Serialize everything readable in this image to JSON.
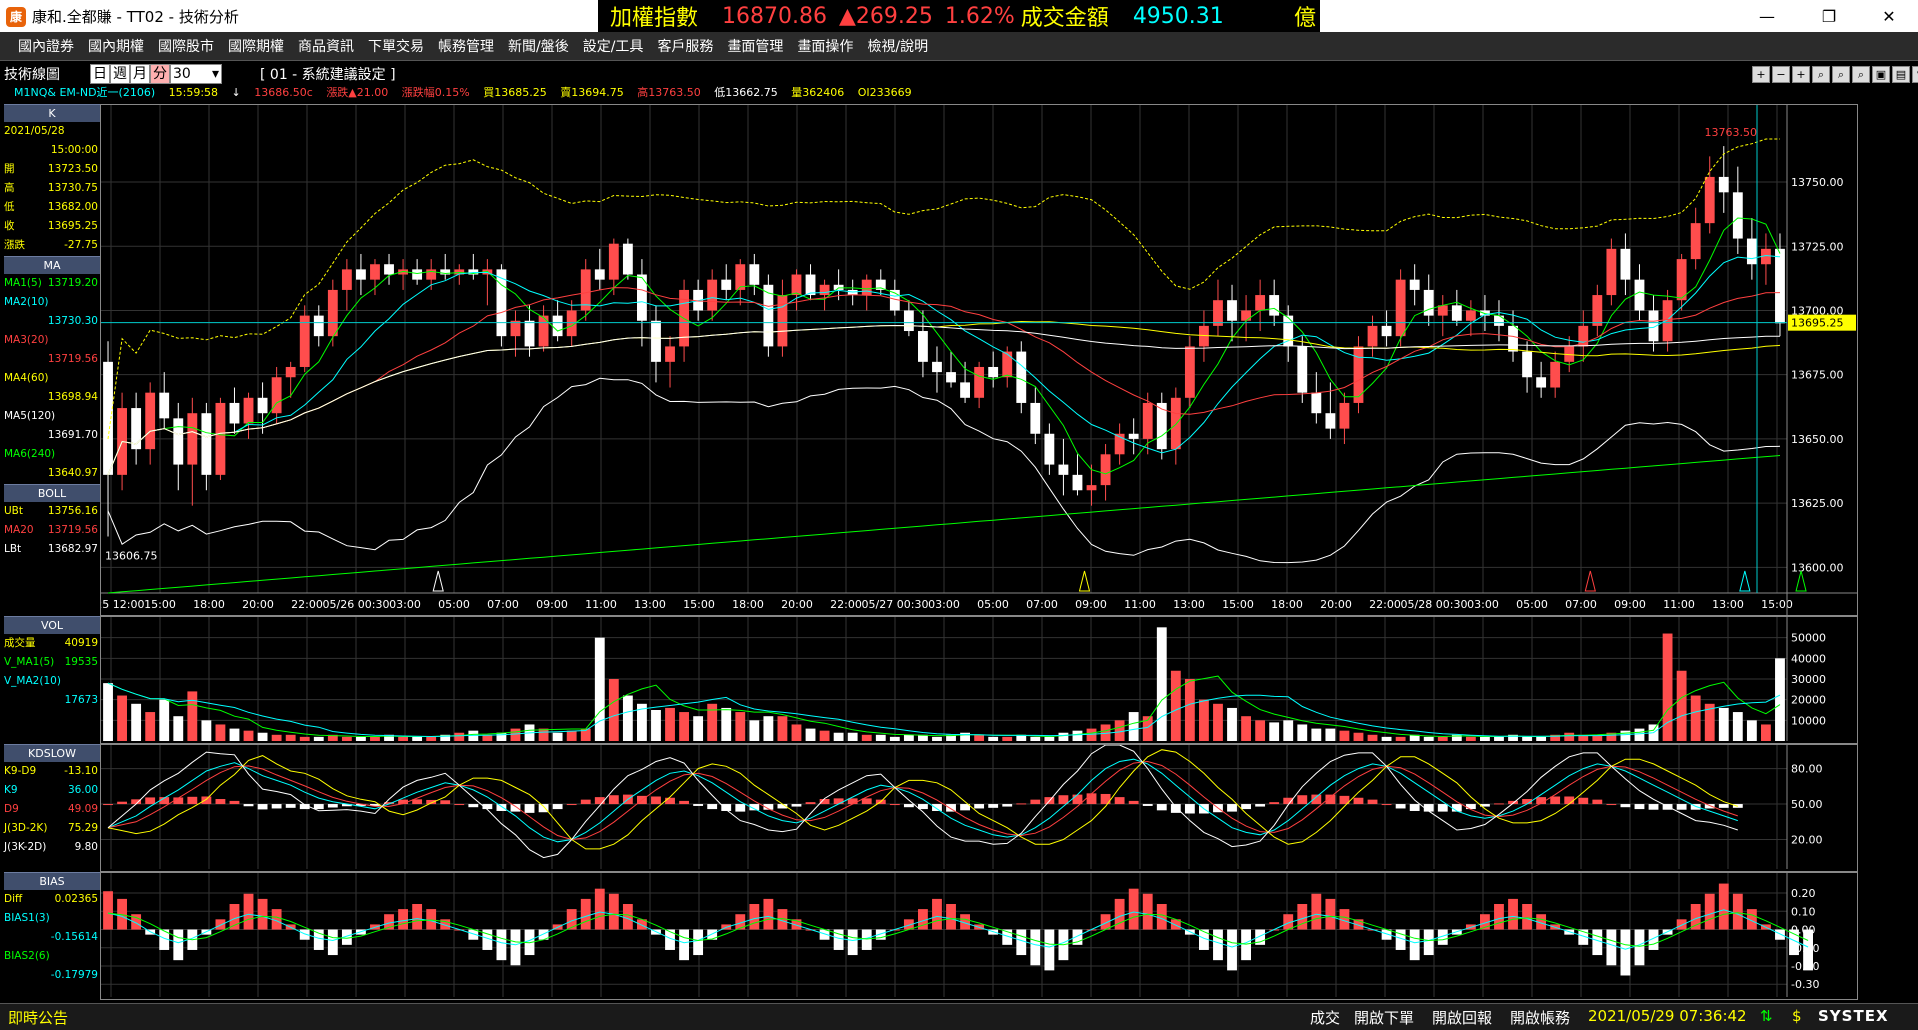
{
  "window": {
    "title": "康和.全都賺 - TT02 - 技術分析",
    "logo_char": "康"
  },
  "ticker": {
    "label": "加權指數",
    "value": "16870.86",
    "change": "▲269.25",
    "percent": "1.62%",
    "turnover_label": "成交金額",
    "turnover": "4950.31",
    "unit": "億",
    "colors": {
      "label": "#ffff00",
      "value": "#ff4040",
      "amount": "#00ffff"
    }
  },
  "menu": [
    "國內證券",
    "國內期權",
    "國際股市",
    "國際期權",
    "商品資訊",
    "下單交易",
    "帳務管理",
    "新聞/盤後",
    "設定/工具",
    "客戶服務",
    "畫面管理",
    "畫面操作",
    "檢視/說明"
  ],
  "toolbar": {
    "panel_title": "技術線圖",
    "periods": [
      "日",
      "週",
      "月",
      "分"
    ],
    "interval": "30",
    "setting": "[ 01 - 系統建議設定 ]"
  },
  "infoline": {
    "symbol": "M1NQ& EM-ND近一(2106)",
    "time": "15:59:58",
    "arrow": "↓",
    "last": "13686.50c",
    "change": "漲跌▲21.00",
    "pct": "漲跌幅0.15%",
    "buy": "買13685.25",
    "sell": "賣13694.75",
    "high": "高13763.50",
    "low": "低13662.75",
    "vol": "量362406",
    "oi": "OI233669"
  },
  "k_panel": {
    "head": "K",
    "date": "2021/05/28",
    "time": "15:00:00",
    "rows": [
      {
        "label": "開",
        "value": "13723.50"
      },
      {
        "label": "高",
        "value": "13730.75"
      },
      {
        "label": "低",
        "value": "13682.00"
      },
      {
        "label": "收",
        "value": "13695.25"
      },
      {
        "label": "漲跌",
        "value": "-27.75"
      }
    ]
  },
  "ma_panel": {
    "head": "MA",
    "rows": [
      {
        "label": "MA1(5)",
        "value": "13719.20",
        "color": "#00ff00"
      },
      {
        "label": "MA2(10)",
        "value": "",
        "color": "#00ffff"
      },
      {
        "label": "",
        "value": "13730.30",
        "color": "#00ffff"
      },
      {
        "label": "MA3(20)",
        "value": "",
        "color": "#ff4040"
      },
      {
        "label": "",
        "value": "13719.56",
        "color": "#ff4040"
      },
      {
        "label": "MA4(60)",
        "value": "",
        "color": "#ffff00"
      },
      {
        "label": "",
        "value": "13698.94",
        "color": "#ffff00"
      },
      {
        "label": "MA5(120)",
        "value": "",
        "color": "#ffffff"
      },
      {
        "label": "",
        "value": "13691.70",
        "color": "#ffffff"
      },
      {
        "label": "MA6(240)",
        "value": "",
        "color": "#00ff00"
      },
      {
        "label": "",
        "value": "13640.97",
        "color": "#ffff00"
      }
    ]
  },
  "boll_panel": {
    "head": "BOLL",
    "rows": [
      {
        "label": "UBt",
        "value": "13756.16",
        "color": "#ffff00"
      },
      {
        "label": "MA20",
        "value": "13719.56",
        "color": "#ff4040"
      },
      {
        "label": "LBt",
        "value": "13682.97",
        "color": "#ffffff"
      }
    ]
  },
  "vol_panel": {
    "head": "VOL",
    "rows": [
      {
        "label": "成交量",
        "value": "40919",
        "color": "#ffff00"
      },
      {
        "label": "V_MA1(5)",
        "value": "19535",
        "color": "#00ff00"
      },
      {
        "label": "V_MA2(10)",
        "value": "",
        "color": "#00ffff"
      },
      {
        "label": "",
        "value": "17673",
        "color": "#00ffff"
      }
    ]
  },
  "kd_panel": {
    "head": "KDSLOW",
    "rows": [
      {
        "label": "K9-D9",
        "value": "-13.10",
        "color": "#ffff00"
      },
      {
        "label": "K9",
        "value": "36.00",
        "color": "#00ffff"
      },
      {
        "label": "D9",
        "value": "49.09",
        "color": "#ff4040"
      },
      {
        "label": "J(3D-2K)",
        "value": "75.29",
        "color": "#ffff00"
      },
      {
        "label": "J(3K-2D)",
        "value": "9.80",
        "color": "#ffffff"
      }
    ]
  },
  "bias_panel": {
    "head": "BIAS",
    "rows": [
      {
        "label": "Diff",
        "value": "0.02365",
        "color": "#ffff00"
      },
      {
        "label": "BIAS1(3)",
        "value": "",
        "color": "#00ffff"
      },
      {
        "label": "",
        "value": "-0.15614",
        "color": "#00ffff"
      },
      {
        "label": "BIAS2(6)",
        "value": "",
        "color": "#00ff00"
      },
      {
        "label": "",
        "value": "-0.17979",
        "color": "#00ffff"
      }
    ]
  },
  "chart_data": {
    "type": "candlestick",
    "price_ticks": [
      "13750.00",
      "13725.00",
      "13700.00",
      "13675.00",
      "13650.00",
      "13625.00",
      "13600.00"
    ],
    "price_range": [
      13590,
      13780
    ],
    "current_price": "13695.25",
    "high_label": "13763.50",
    "low_label": "13606.75",
    "time_ticks": [
      "05/25 12:00",
      "15:00",
      "18:00",
      "20:00",
      "22:00",
      "05/26 00:30",
      "03:00",
      "05:00",
      "07:00",
      "09:00",
      "11:00",
      "13:00",
      "15:00",
      "18:00",
      "20:00",
      "22:00",
      "05/27 00:30",
      "03:00",
      "05:00",
      "07:00",
      "09:00",
      "11:00",
      "13:00",
      "15:00",
      "18:00",
      "20:00",
      "22:00",
      "05/28 00:30",
      "03:00",
      "05:00",
      "07:00",
      "09:00",
      "11:00",
      "13:00",
      "15:00"
    ],
    "vol_ticks": [
      "50000",
      "40000",
      "30000",
      "20000",
      "10000"
    ],
    "kd_ticks": [
      "80.00",
      "50.00",
      "20.00"
    ],
    "bias_ticks": [
      "0.20",
      "0.10",
      "0.00",
      "-0.10",
      "-0.20",
      "-0.30"
    ],
    "candles": [
      [
        13680,
        13688,
        13612,
        13636
      ],
      [
        13636,
        13668,
        13630,
        13662
      ],
      [
        13662,
        13668,
        13640,
        13646
      ],
      [
        13646,
        13672,
        13640,
        13668
      ],
      [
        13668,
        13676,
        13654,
        13658
      ],
      [
        13658,
        13664,
        13630,
        13640
      ],
      [
        13640,
        13666,
        13624,
        13660
      ],
      [
        13660,
        13664,
        13630,
        13636
      ],
      [
        13636,
        13666,
        13634,
        13664
      ],
      [
        13664,
        13670,
        13652,
        13656
      ],
      [
        13656,
        13668,
        13650,
        13666
      ],
      [
        13666,
        13672,
        13652,
        13660
      ],
      [
        13660,
        13678,
        13656,
        13674
      ],
      [
        13674,
        13680,
        13666,
        13678
      ],
      [
        13678,
        13702,
        13676,
        13698
      ],
      [
        13698,
        13702,
        13686,
        13690
      ],
      [
        13690,
        13712,
        13686,
        13708
      ],
      [
        13708,
        13720,
        13700,
        13716
      ],
      [
        13716,
        13722,
        13706,
        13712
      ],
      [
        13712,
        13720,
        13706,
        13718
      ],
      [
        13718,
        13722,
        13710,
        13714
      ],
      [
        13714,
        13720,
        13708,
        13716
      ],
      [
        13716,
        13720,
        13710,
        13712
      ],
      [
        13712,
        13720,
        13708,
        13716
      ],
      [
        13716,
        13722,
        13712,
        13714
      ],
      [
        13714,
        13718,
        13710,
        13716
      ],
      [
        13716,
        13722,
        13712,
        13714
      ],
      [
        13714,
        13720,
        13702,
        13716
      ],
      [
        13716,
        13718,
        13686,
        13690
      ],
      [
        13690,
        13700,
        13682,
        13696
      ],
      [
        13696,
        13702,
        13682,
        13686
      ],
      [
        13686,
        13702,
        13684,
        13698
      ],
      [
        13698,
        13704,
        13688,
        13690
      ],
      [
        13690,
        13704,
        13686,
        13700
      ],
      [
        13700,
        13720,
        13696,
        13716
      ],
      [
        13716,
        13724,
        13708,
        13712
      ],
      [
        13712,
        13728,
        13706,
        13726
      ],
      [
        13726,
        13728,
        13712,
        13714
      ],
      [
        13714,
        13720,
        13686,
        13696
      ],
      [
        13696,
        13702,
        13672,
        13680
      ],
      [
        13680,
        13690,
        13670,
        13686
      ],
      [
        13686,
        13712,
        13680,
        13708
      ],
      [
        13708,
        13712,
        13696,
        13700
      ],
      [
        13700,
        13716,
        13696,
        13712
      ],
      [
        13712,
        13718,
        13704,
        13708
      ],
      [
        13708,
        13720,
        13702,
        13718
      ],
      [
        13718,
        13722,
        13706,
        13710
      ],
      [
        13710,
        13714,
        13682,
        13686
      ],
      [
        13686,
        13712,
        13682,
        13706
      ],
      [
        13706,
        13716,
        13700,
        13714
      ],
      [
        13714,
        13718,
        13704,
        13706
      ],
      [
        13706,
        13712,
        13700,
        13710
      ],
      [
        13710,
        13716,
        13704,
        13708
      ],
      [
        13708,
        13712,
        13702,
        13706
      ],
      [
        13706,
        13714,
        13700,
        13712
      ],
      [
        13712,
        13716,
        13706,
        13708
      ],
      [
        13708,
        13712,
        13698,
        13700
      ],
      [
        13700,
        13704,
        13690,
        13692
      ],
      [
        13692,
        13700,
        13674,
        13680
      ],
      [
        13680,
        13686,
        13668,
        13676
      ],
      [
        13676,
        13684,
        13670,
        13672
      ],
      [
        13672,
        13680,
        13664,
        13666
      ],
      [
        13666,
        13680,
        13662,
        13678
      ],
      [
        13678,
        13684,
        13670,
        13674
      ],
      [
        13674,
        13686,
        13670,
        13684
      ],
      [
        13684,
        13688,
        13660,
        13664
      ],
      [
        13664,
        13670,
        13648,
        13652
      ],
      [
        13652,
        13656,
        13636,
        13640
      ],
      [
        13640,
        13650,
        13628,
        13636
      ],
      [
        13636,
        13644,
        13628,
        13630
      ],
      [
        13630,
        13640,
        13624,
        13632
      ],
      [
        13632,
        13648,
        13626,
        13644
      ],
      [
        13644,
        13656,
        13640,
        13652
      ],
      [
        13652,
        13658,
        13644,
        13650
      ],
      [
        13650,
        13668,
        13644,
        13664
      ],
      [
        13664,
        13668,
        13642,
        13646
      ],
      [
        13646,
        13670,
        13640,
        13666
      ],
      [
        13666,
        13690,
        13662,
        13686
      ],
      [
        13686,
        13700,
        13680,
        13694
      ],
      [
        13694,
        13712,
        13690,
        13704
      ],
      [
        13704,
        13710,
        13688,
        13696
      ],
      [
        13696,
        13706,
        13688,
        13700
      ],
      [
        13700,
        13712,
        13692,
        13706
      ],
      [
        13706,
        13712,
        13694,
        13698
      ],
      [
        13698,
        13702,
        13680,
        13686
      ],
      [
        13686,
        13690,
        13664,
        13668
      ],
      [
        13668,
        13676,
        13656,
        13660
      ],
      [
        13660,
        13672,
        13650,
        13654
      ],
      [
        13654,
        13668,
        13648,
        13664
      ],
      [
        13664,
        13690,
        13660,
        13686
      ],
      [
        13686,
        13698,
        13682,
        13694
      ],
      [
        13694,
        13700,
        13686,
        13690
      ],
      [
        13690,
        13716,
        13686,
        13712
      ],
      [
        13712,
        13718,
        13702,
        13708
      ],
      [
        13708,
        13714,
        13694,
        13698
      ],
      [
        13698,
        13706,
        13690,
        13702
      ],
      [
        13702,
        13708,
        13694,
        13696
      ],
      [
        13696,
        13704,
        13690,
        13700
      ],
      [
        13700,
        13706,
        13692,
        13698
      ],
      [
        13698,
        13704,
        13688,
        13694
      ],
      [
        13694,
        13700,
        13680,
        13684
      ],
      [
        13684,
        13688,
        13668,
        13674
      ],
      [
        13674,
        13680,
        13666,
        13670
      ],
      [
        13670,
        13684,
        13666,
        13680
      ],
      [
        13680,
        13690,
        13676,
        13686
      ],
      [
        13686,
        13700,
        13680,
        13694
      ],
      [
        13694,
        13710,
        13690,
        13706
      ],
      [
        13706,
        13728,
        13702,
        13724
      ],
      [
        13724,
        13730,
        13706,
        13712
      ],
      [
        13712,
        13718,
        13696,
        13700
      ],
      [
        13700,
        13706,
        13684,
        13688
      ],
      [
        13688,
        13708,
        13684,
        13704
      ],
      [
        13704,
        13722,
        13700,
        13720
      ],
      [
        13720,
        13740,
        13716,
        13734
      ],
      [
        13734,
        13760,
        13730,
        13752
      ],
      [
        13752,
        13764,
        13738,
        13746
      ],
      [
        13746,
        13756,
        13722,
        13728
      ],
      [
        13728,
        13736,
        13712,
        13718
      ],
      [
        13718,
        13730,
        13710,
        13724
      ],
      [
        13724,
        13730,
        13690,
        13695
      ]
    ],
    "volume": [
      28,
      22,
      18,
      14,
      20,
      12,
      24,
      10,
      8,
      6,
      5,
      4,
      3,
      3,
      2,
      2,
      3,
      2,
      2,
      2,
      3,
      2,
      2,
      2,
      3,
      4,
      5,
      3,
      4,
      6,
      8,
      6,
      4,
      5,
      6,
      50,
      30,
      22,
      18,
      15,
      16,
      14,
      12,
      18,
      16,
      14,
      10,
      12,
      12,
      8,
      6,
      5,
      4,
      4,
      3,
      3,
      2,
      3,
      3,
      2,
      3,
      4,
      3,
      2,
      2,
      3,
      2,
      2,
      4,
      5,
      6,
      8,
      10,
      14,
      12,
      55,
      34,
      30,
      20,
      18,
      16,
      12,
      10,
      9,
      10,
      8,
      6,
      6,
      5,
      4,
      3,
      2,
      2,
      3,
      2,
      2,
      3,
      2,
      2,
      2,
      3,
      2,
      2,
      3,
      4,
      3,
      3,
      4,
      5,
      6,
      8,
      52,
      34,
      22,
      18,
      16,
      14,
      10,
      8,
      40
    ],
    "kd_k": [
      30,
      35,
      40,
      48,
      55,
      62,
      70,
      78,
      82,
      85,
      80,
      74,
      70,
      66,
      60,
      55,
      52,
      50,
      48,
      46,
      50,
      55,
      60,
      64,
      68,
      66,
      62,
      56,
      48,
      40,
      30,
      22,
      18,
      20,
      26,
      34,
      44,
      54,
      62,
      70,
      76,
      78,
      74,
      68,
      60,
      52,
      46,
      40,
      36,
      34,
      38,
      44,
      50,
      56,
      62,
      66,
      64,
      60,
      54,
      46,
      38,
      32,
      28,
      24,
      22,
      24,
      30,
      38,
      48,
      58,
      70,
      80,
      86,
      88,
      84,
      76,
      66,
      56,
      46,
      38,
      30,
      26,
      24,
      28,
      36,
      46,
      56,
      66,
      74,
      80,
      84,
      82,
      76,
      68,
      60,
      52,
      44,
      40,
      38,
      40,
      44,
      50,
      58,
      66,
      74,
      80,
      84,
      82,
      78,
      72,
      66,
      60,
      54,
      48,
      44,
      40,
      36
    ],
    "bias1": [
      0.15,
      0.12,
      0.06,
      -0.02,
      -0.08,
      -0.12,
      -0.08,
      -0.02,
      0.04,
      0.1,
      0.14,
      0.12,
      0.08,
      0.02,
      -0.04,
      -0.08,
      -0.1,
      -0.06,
      -0.02,
      0.02,
      0.06,
      0.08,
      0.1,
      0.08,
      0.04,
      0.0,
      -0.04,
      -0.08,
      -0.12,
      -0.14,
      -0.1,
      -0.04,
      0.02,
      0.08,
      0.12,
      0.16,
      0.14,
      0.1,
      0.04,
      -0.02,
      -0.08,
      -0.12,
      -0.1,
      -0.04,
      0.02,
      0.06,
      0.1,
      0.12,
      0.08,
      0.04,
      0.0,
      -0.04,
      -0.08,
      -0.1,
      -0.08,
      -0.04,
      0.0,
      0.04,
      0.08,
      0.12,
      0.1,
      0.06,
      0.02,
      -0.02,
      -0.06,
      -0.1,
      -0.14,
      -0.16,
      -0.12,
      -0.06,
      0.0,
      0.06,
      0.12,
      0.16,
      0.14,
      0.1,
      0.04,
      -0.02,
      -0.08,
      -0.12,
      -0.16,
      -0.12,
      -0.06,
      0.0,
      0.06,
      0.1,
      0.14,
      0.12,
      0.08,
      0.04,
      0.0,
      -0.04,
      -0.08,
      -0.12,
      -0.1,
      -0.06,
      -0.02,
      0.02,
      0.06,
      0.1,
      0.12,
      0.1,
      0.06,
      0.02,
      -0.02,
      -0.06,
      -0.1,
      -0.14,
      -0.18,
      -0.14,
      -0.08,
      -0.02,
      0.04,
      0.1,
      0.14,
      0.18,
      0.14,
      0.08,
      0.02,
      -0.04,
      -0.1,
      -0.16
    ]
  },
  "status": {
    "left": "即時公告",
    "items": [
      "成交",
      "開啟下單",
      "開啟回報",
      "開啟帳務"
    ],
    "clock": "2021/05/29 07:36:42",
    "brand": "SYSTEX"
  }
}
